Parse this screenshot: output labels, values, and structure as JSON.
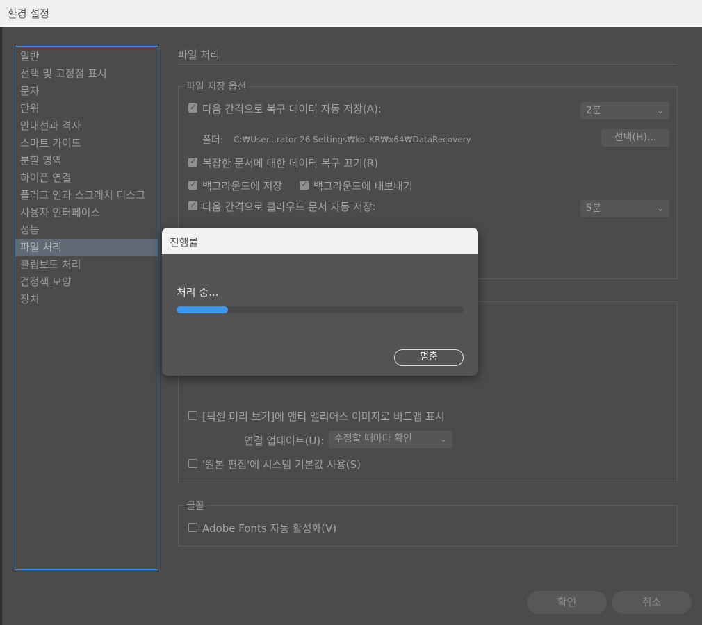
{
  "window": {
    "title": "환경 설정"
  },
  "sidebar": {
    "items": [
      {
        "label": "일반"
      },
      {
        "label": "선택 및 고정점 표시"
      },
      {
        "label": "문자"
      },
      {
        "label": "단위"
      },
      {
        "label": "안내선과 격자"
      },
      {
        "label": "스마트 가이드"
      },
      {
        "label": "분할 영역"
      },
      {
        "label": "하이픈 연결"
      },
      {
        "label": "플러그 인과 스크래치 디스크"
      },
      {
        "label": "사용자 인터페이스"
      },
      {
        "label": "성능"
      },
      {
        "label": "파일 처리"
      },
      {
        "label": "클립보드 처리"
      },
      {
        "label": "검정색 모양"
      },
      {
        "label": "장치"
      }
    ],
    "active_index": 11
  },
  "panel": {
    "title": "파일 처리",
    "save_group": {
      "legend": "파일 저장 옵션",
      "auto_save_label": "다음 간격으로 복구 데이터 자동 저장(A):",
      "auto_save_checked": true,
      "auto_save_interval": "2분",
      "folder_label": "폴더:",
      "folder_path": "C:₩User...rator 26 Settings₩ko_KR₩x64₩DataRecovery",
      "choose_button": "선택(H)...",
      "complex_doc_label": "복잡한 문서에 대한 데이터 복구 끄기(R)",
      "complex_doc_checked": true,
      "bg_save_label": "백그라운드에 저장",
      "bg_save_checked": true,
      "bg_export_label": "백그라운드에 내보내기",
      "bg_export_checked": true,
      "cloud_save_label": "다음 간격으로 클라우드 문서 자동 저장:",
      "cloud_save_checked": true,
      "cloud_interval": "5분"
    },
    "links_group": {
      "pixel_preview_label": "[픽셀 미리 보기]에 앤티 앨리어스 이미지로 비트맵 표시",
      "pixel_preview_checked": false,
      "link_update_label": "연결 업데이트(U):",
      "link_update_value": "수정할 때마다 확인",
      "system_default_label": "'원본 편집'에 시스템 기본값 사용(S)",
      "system_default_checked": false
    },
    "fonts_group": {
      "legend": "글꼴",
      "adobe_fonts_label": "Adobe Fonts 자동 활성화(V)",
      "adobe_fonts_checked": false
    }
  },
  "footer": {
    "ok_label": "확인",
    "cancel_label": "취소"
  },
  "progress_dialog": {
    "title": "진행률",
    "message": "처리 중...",
    "progress_fraction": 0.18,
    "stop_label": "멈춤",
    "bar_color": "#3b95ec"
  }
}
